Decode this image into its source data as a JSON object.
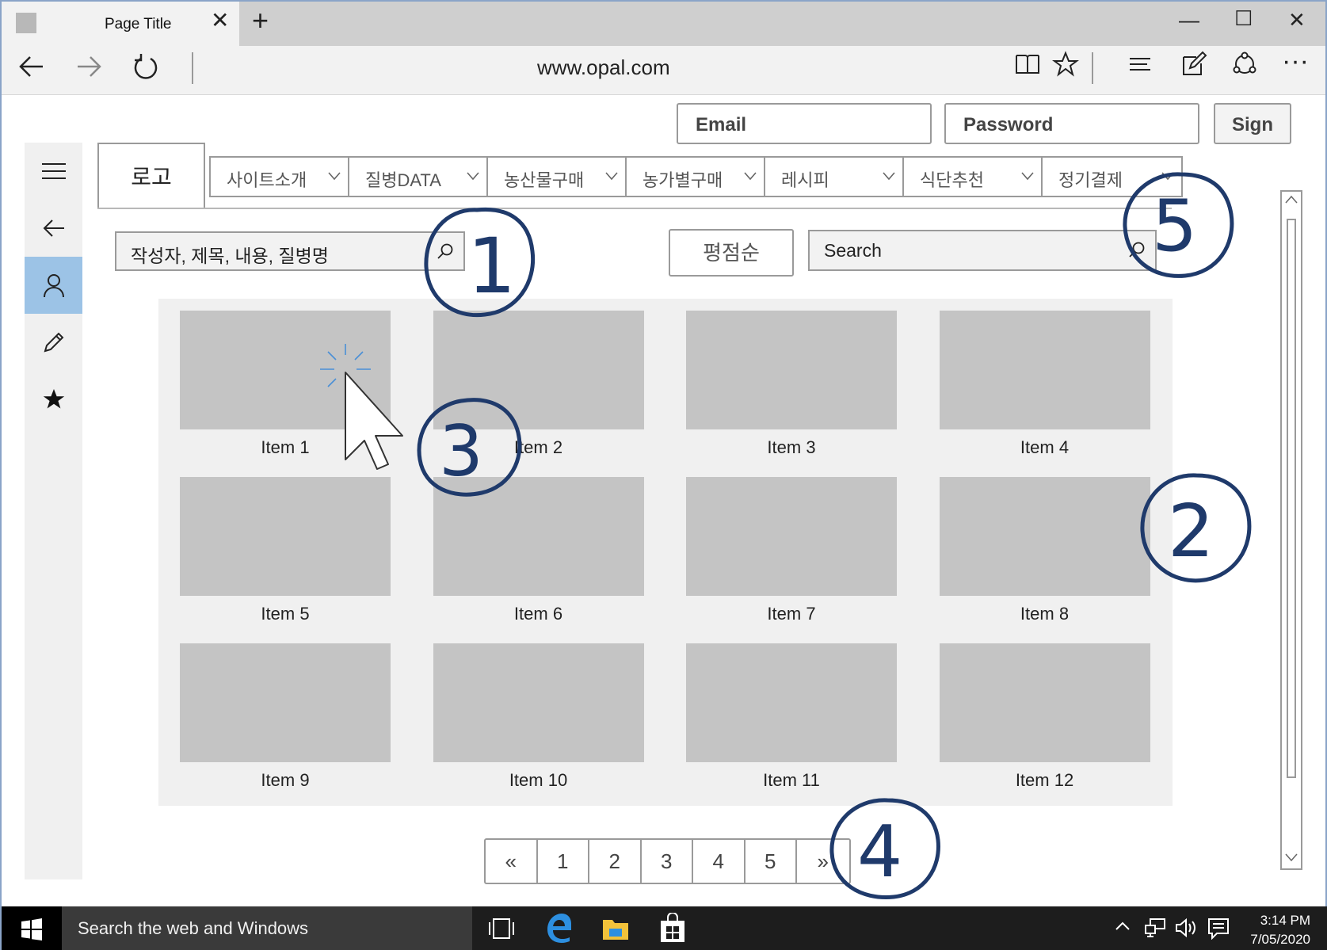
{
  "browser": {
    "tab_title": "Page Title",
    "url": "www.opal.com"
  },
  "login": {
    "email_label": "Email",
    "password_label": "Password",
    "sign_label": "Sign"
  },
  "logo": "로고",
  "menu": {
    "items": [
      "사이트소개",
      "질병DATA",
      "농산물구매",
      "농가별구매",
      "레시피",
      "식단추천",
      "정기결제"
    ]
  },
  "search_left": {
    "placeholder": "작성자, 제목, 내용, 질병명"
  },
  "sort": {
    "label": "평점순"
  },
  "search_right": {
    "placeholder": "Search"
  },
  "grid": {
    "items": [
      "Item 1",
      "Item 2",
      "Item 3",
      "Item 4",
      "Item 5",
      "Item 6",
      "Item 7",
      "Item 8",
      "Item 9",
      "Item 10",
      "Item 11",
      "Item 12"
    ]
  },
  "pagination": {
    "pages": [
      "«",
      "1",
      "2",
      "3",
      "4",
      "5",
      "»"
    ]
  },
  "annotations": [
    "1",
    "2",
    "3",
    "4",
    "5"
  ],
  "taskbar": {
    "search_text": "Search the web and Windows",
    "time": "3:14 PM",
    "date": "7/05/2020"
  },
  "colors": {
    "active_rail": "#9cc3e6",
    "annotation_ink": "#1f3a6b",
    "thumb": "#c4c4c4",
    "taskbar": "#1d1d1d"
  }
}
